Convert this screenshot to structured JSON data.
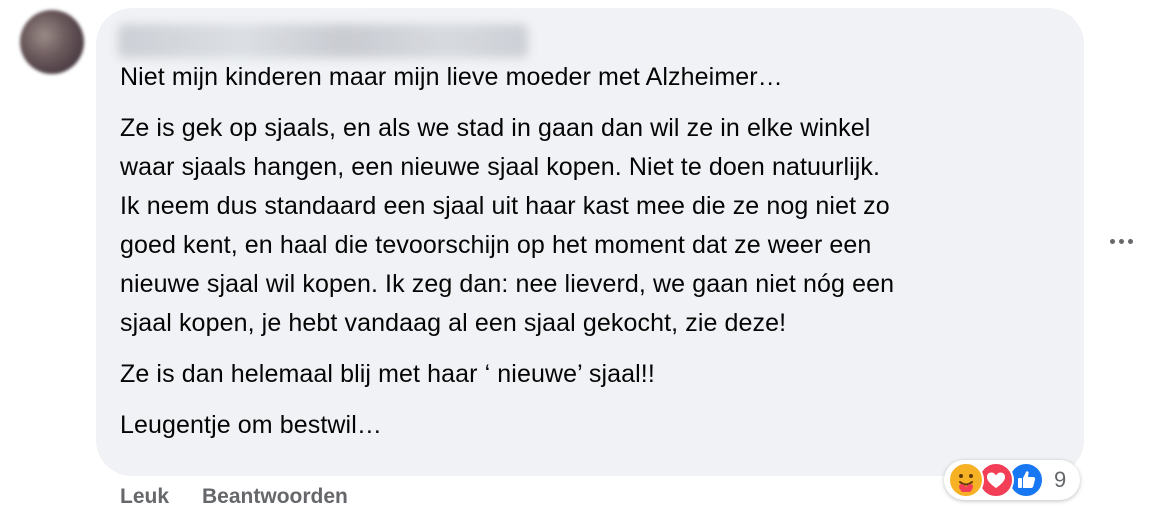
{
  "comment": {
    "author_name": "",
    "paragraphs": [
      [
        "Niet mijn kinderen maar mijn lieve moeder met Alzheimer…"
      ],
      [
        "Ze is gek op sjaals, en als we stad in gaan dan wil ze in elke winkel",
        "waar sjaals hangen, een nieuwe sjaal kopen. Niet te doen natuurlijk.",
        "Ik neem dus standaard een sjaal uit haar kast mee die ze nog niet zo",
        "goed kent, en haal die tevoorschijn op het moment dat ze weer een",
        "nieuwe sjaal wil kopen. Ik zeg dan: nee lieverd, we gaan niet nóg een",
        "sjaal kopen, je hebt vandaag al een sjaal gekocht, zie deze!"
      ],
      [
        "Ze is dan helemaal blij met haar ‘ nieuwe’ sjaal!!"
      ],
      [
        "Leugentje om bestwil…"
      ]
    ],
    "more_icon": "more-horizontal-icon",
    "reactions": {
      "icons": [
        "care-reaction-icon",
        "love-reaction-icon",
        "like-reaction-icon"
      ],
      "count": "9"
    },
    "actions": {
      "like_label": "Leuk",
      "reply_label": "Beantwoorden"
    }
  },
  "colors": {
    "bubble_background": "#f0f2f5",
    "text": "#050505",
    "secondary_text": "#65676b",
    "like_blue": "#1877f2",
    "love_red": "#f33e58",
    "care_yellow": "#f7b125"
  }
}
